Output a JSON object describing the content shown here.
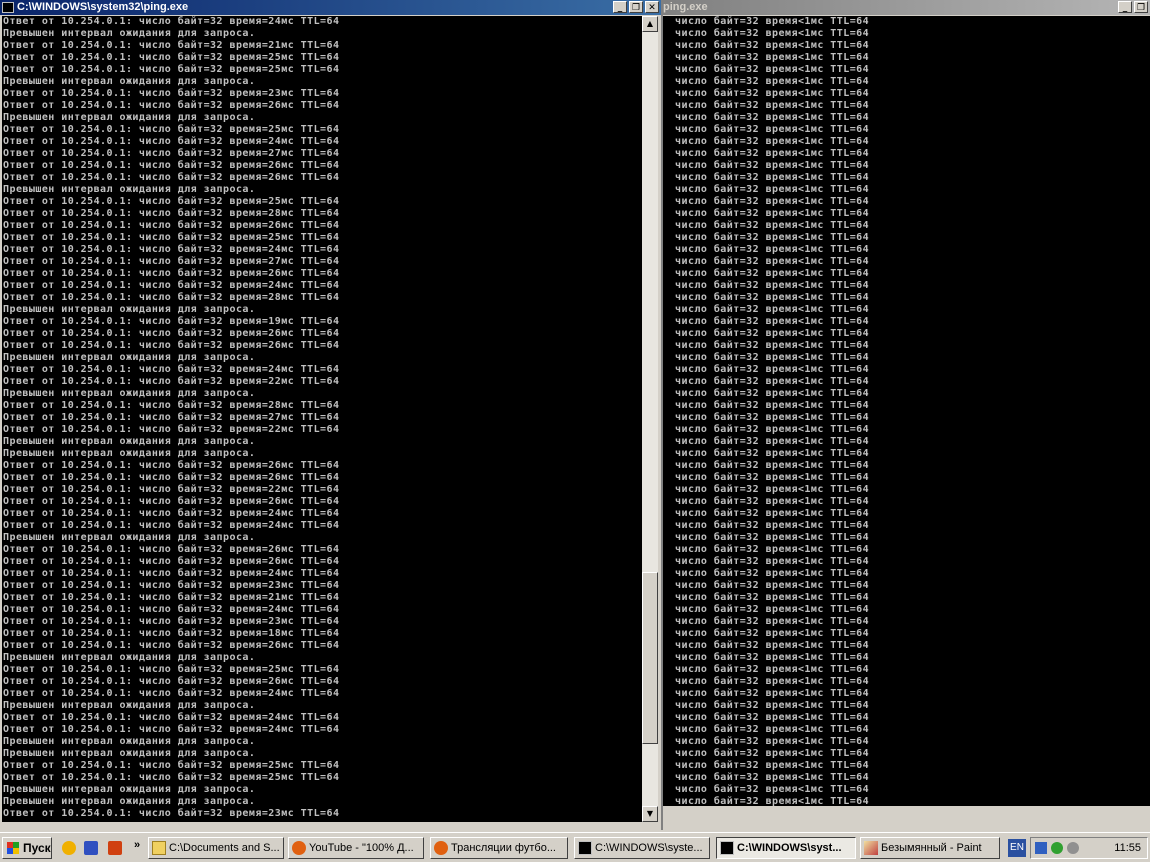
{
  "left_window": {
    "title": "C:\\WINDOWS\\system32\\ping.exe",
    "lines": [
      "Ответ от 10.254.0.1: число байт=32 время=24мс TTL=64",
      "Превышен интервал ожидания для запроса.",
      "Ответ от 10.254.0.1: число байт=32 время=21мс TTL=64",
      "Ответ от 10.254.0.1: число байт=32 время=25мс TTL=64",
      "Ответ от 10.254.0.1: число байт=32 время=25мс TTL=64",
      "Превышен интервал ожидания для запроса.",
      "Ответ от 10.254.0.1: число байт=32 время=23мс TTL=64",
      "Ответ от 10.254.0.1: число байт=32 время=26мс TTL=64",
      "Превышен интервал ожидания для запроса.",
      "Ответ от 10.254.0.1: число байт=32 время=25мс TTL=64",
      "Ответ от 10.254.0.1: число байт=32 время=24мс TTL=64",
      "Ответ от 10.254.0.1: число байт=32 время=27мс TTL=64",
      "Ответ от 10.254.0.1: число байт=32 время=26мс TTL=64",
      "Ответ от 10.254.0.1: число байт=32 время=26мс TTL=64",
      "Превышен интервал ожидания для запроса.",
      "Ответ от 10.254.0.1: число байт=32 время=25мс TTL=64",
      "Ответ от 10.254.0.1: число байт=32 время=28мс TTL=64",
      "Ответ от 10.254.0.1: число байт=32 время=26мс TTL=64",
      "Ответ от 10.254.0.1: число байт=32 время=25мс TTL=64",
      "Ответ от 10.254.0.1: число байт=32 время=24мс TTL=64",
      "Ответ от 10.254.0.1: число байт=32 время=27мс TTL=64",
      "Ответ от 10.254.0.1: число байт=32 время=26мс TTL=64",
      "Ответ от 10.254.0.1: число байт=32 время=24мс TTL=64",
      "Ответ от 10.254.0.1: число байт=32 время=28мс TTL=64",
      "Превышен интервал ожидания для запроса.",
      "Ответ от 10.254.0.1: число байт=32 время=19мс TTL=64",
      "Ответ от 10.254.0.1: число байт=32 время=26мс TTL=64",
      "Ответ от 10.254.0.1: число байт=32 время=26мс TTL=64",
      "Превышен интервал ожидания для запроса.",
      "Ответ от 10.254.0.1: число байт=32 время=24мс TTL=64",
      "Ответ от 10.254.0.1: число байт=32 время=22мс TTL=64",
      "Превышен интервал ожидания для запроса.",
      "Ответ от 10.254.0.1: число байт=32 время=28мс TTL=64",
      "Ответ от 10.254.0.1: число байт=32 время=27мс TTL=64",
      "Ответ от 10.254.0.1: число байт=32 время=22мс TTL=64",
      "Превышен интервал ожидания для запроса.",
      "Превышен интервал ожидания для запроса.",
      "Ответ от 10.254.0.1: число байт=32 время=26мс TTL=64",
      "Ответ от 10.254.0.1: число байт=32 время=26мс TTL=64",
      "Ответ от 10.254.0.1: число байт=32 время=22мс TTL=64",
      "Ответ от 10.254.0.1: число байт=32 время=26мс TTL=64",
      "Ответ от 10.254.0.1: число байт=32 время=24мс TTL=64",
      "Ответ от 10.254.0.1: число байт=32 время=24мс TTL=64",
      "Превышен интервал ожидания для запроса.",
      "Ответ от 10.254.0.1: число байт=32 время=26мс TTL=64",
      "Ответ от 10.254.0.1: число байт=32 время=26мс TTL=64",
      "Ответ от 10.254.0.1: число байт=32 время=24мс TTL=64",
      "Ответ от 10.254.0.1: число байт=32 время=23мс TTL=64",
      "Ответ от 10.254.0.1: число байт=32 время=21мс TTL=64",
      "Ответ от 10.254.0.1: число байт=32 время=24мс TTL=64",
      "Ответ от 10.254.0.1: число байт=32 время=23мс TTL=64",
      "Ответ от 10.254.0.1: число байт=32 время=18мс TTL=64",
      "Ответ от 10.254.0.1: число байт=32 время=26мс TTL=64",
      "Превышен интервал ожидания для запроса.",
      "Ответ от 10.254.0.1: число байт=32 время=25мс TTL=64",
      "Ответ от 10.254.0.1: число байт=32 время=26мс TTL=64",
      "Ответ от 10.254.0.1: число байт=32 время=24мс TTL=64",
      "Превышен интервал ожидания для запроса.",
      "Ответ от 10.254.0.1: число байт=32 время=24мс TTL=64",
      "Ответ от 10.254.0.1: число байт=32 время=24мс TTL=64",
      "Превышен интервал ожидания для запроса.",
      "Превышен интервал ожидания для запроса.",
      "Ответ от 10.254.0.1: число байт=32 время=25мс TTL=64",
      "Ответ от 10.254.0.1: число байт=32 время=25мс TTL=64",
      "Превышен интервал ожидания для запроса.",
      "Превышен интервал ожидания для запроса.",
      "Ответ от 10.254.0.1: число байт=32 время=23мс TTL=64"
    ]
  },
  "right_window": {
    "title": "ping.exe",
    "lines": [
      "число байт=32 время<1мс TTL=64",
      "число байт=32 время<1мс TTL=64",
      "число байт=32 время<1мс TTL=64",
      "число байт=32 время<1мс TTL=64",
      "число байт=32 время<1мс TTL=64",
      "число байт=32 время<1мс TTL=64",
      "число байт=32 время<1мс TTL=64",
      "число байт=32 время<1мс TTL=64",
      "число байт=32 время<1мс TTL=64",
      "число байт=32 время<1мс TTL=64",
      "число байт=32 время<1мс TTL=64",
      "число байт=32 время<1мс TTL=64",
      "число байт=32 время<1мс TTL=64",
      "число байт=32 время<1мс TTL=64",
      "число байт=32 время<1мс TTL=64",
      "число байт=32 время<1мс TTL=64",
      "число байт=32 время<1мс TTL=64",
      "число байт=32 время<1мс TTL=64",
      "число байт=32 время<1мс TTL=64",
      "число байт=32 время<1мс TTL=64",
      "число байт=32 время<1мс TTL=64",
      "число байт=32 время<1мс TTL=64",
      "число байт=32 время<1мс TTL=64",
      "число байт=32 время<1мс TTL=64",
      "число байт=32 время<1мс TTL=64",
      "число байт=32 время<1мс TTL=64",
      "число байт=32 время<1мс TTL=64",
      "число байт=32 время<1мс TTL=64",
      "число байт=32 время<1мс TTL=64",
      "число байт=32 время<1мс TTL=64",
      "число байт=32 время<1мс TTL=64",
      "число байт=32 время<1мс TTL=64",
      "число байт=32 время<1мс TTL=64",
      "число байт=32 время<1мс TTL=64",
      "число байт=32 время<1мс TTL=64",
      "число байт=32 время<1мс TTL=64",
      "число байт=32 время<1мс TTL=64",
      "число байт=32 время<1мс TTL=64",
      "число байт=32 время<1мс TTL=64",
      "число байт=32 время<1мс TTL=64",
      "число байт=32 время<1мс TTL=64",
      "число байт=32 время<1мс TTL=64",
      "число байт=32 время<1мс TTL=64",
      "число байт=32 время<1мс TTL=64",
      "число байт=32 время<1мс TTL=64",
      "число байт=32 время<1мс TTL=64",
      "число байт=32 время<1мс TTL=64",
      "число байт=32 время<1мс TTL=64",
      "число байт=32 время<1мс TTL=64",
      "число байт=32 время<1мс TTL=64",
      "число байт=32 время<1мс TTL=64",
      "число байт=32 время<1мс TTL=64",
      "число байт=32 время<1мс TTL=64",
      "число байт=32 время<1мс TTL=64",
      "число байт=32 время<1мс TTL=64",
      "число байт=32 время<1мс TTL=64",
      "число байт=32 время<1мс TTL=64",
      "число байт=32 время<1мс TTL=64",
      "число байт=32 время<1мс TTL=64",
      "число байт=32 время<1мс TTL=64",
      "число байт=32 время<1мс TTL=64",
      "число байт=32 время<1мс TTL=64",
      "число байт=32 время<1мс TTL=64",
      "число байт=32 время<1мс TTL=64",
      "число байт=32 время<1мс TTL=64",
      "число байт=32 время<1мс TTL=64"
    ]
  },
  "window_buttons": {
    "minimize": "_",
    "maximize": "□",
    "restore": "❐",
    "close": "✕"
  },
  "scrollbar": {
    "up": "▲",
    "down": "▼"
  },
  "taskbar": {
    "start_label": "Пуск",
    "more_label": "»",
    "buttons": [
      {
        "label": "C:\\Documents and S...",
        "icon": "folder-icon"
      },
      {
        "label": "YouTube - \"100% Д...",
        "icon": "firefox-icon"
      },
      {
        "label": "Трансляции футбо...",
        "icon": "firefox-icon"
      },
      {
        "label": "C:\\WINDOWS\\syste...",
        "icon": "console-icon"
      },
      {
        "label": "C:\\WINDOWS\\syst...",
        "icon": "console-icon"
      },
      {
        "label": "Безымянный - Paint",
        "icon": "paint-icon"
      }
    ],
    "lang": "EN",
    "clock": "11:55"
  },
  "colors": {
    "console_bg": "#000000",
    "console_text": "#c0c0c0",
    "title_active": "#0a246a",
    "title_inactive": "#808080",
    "chrome": "#d4d0c8"
  }
}
